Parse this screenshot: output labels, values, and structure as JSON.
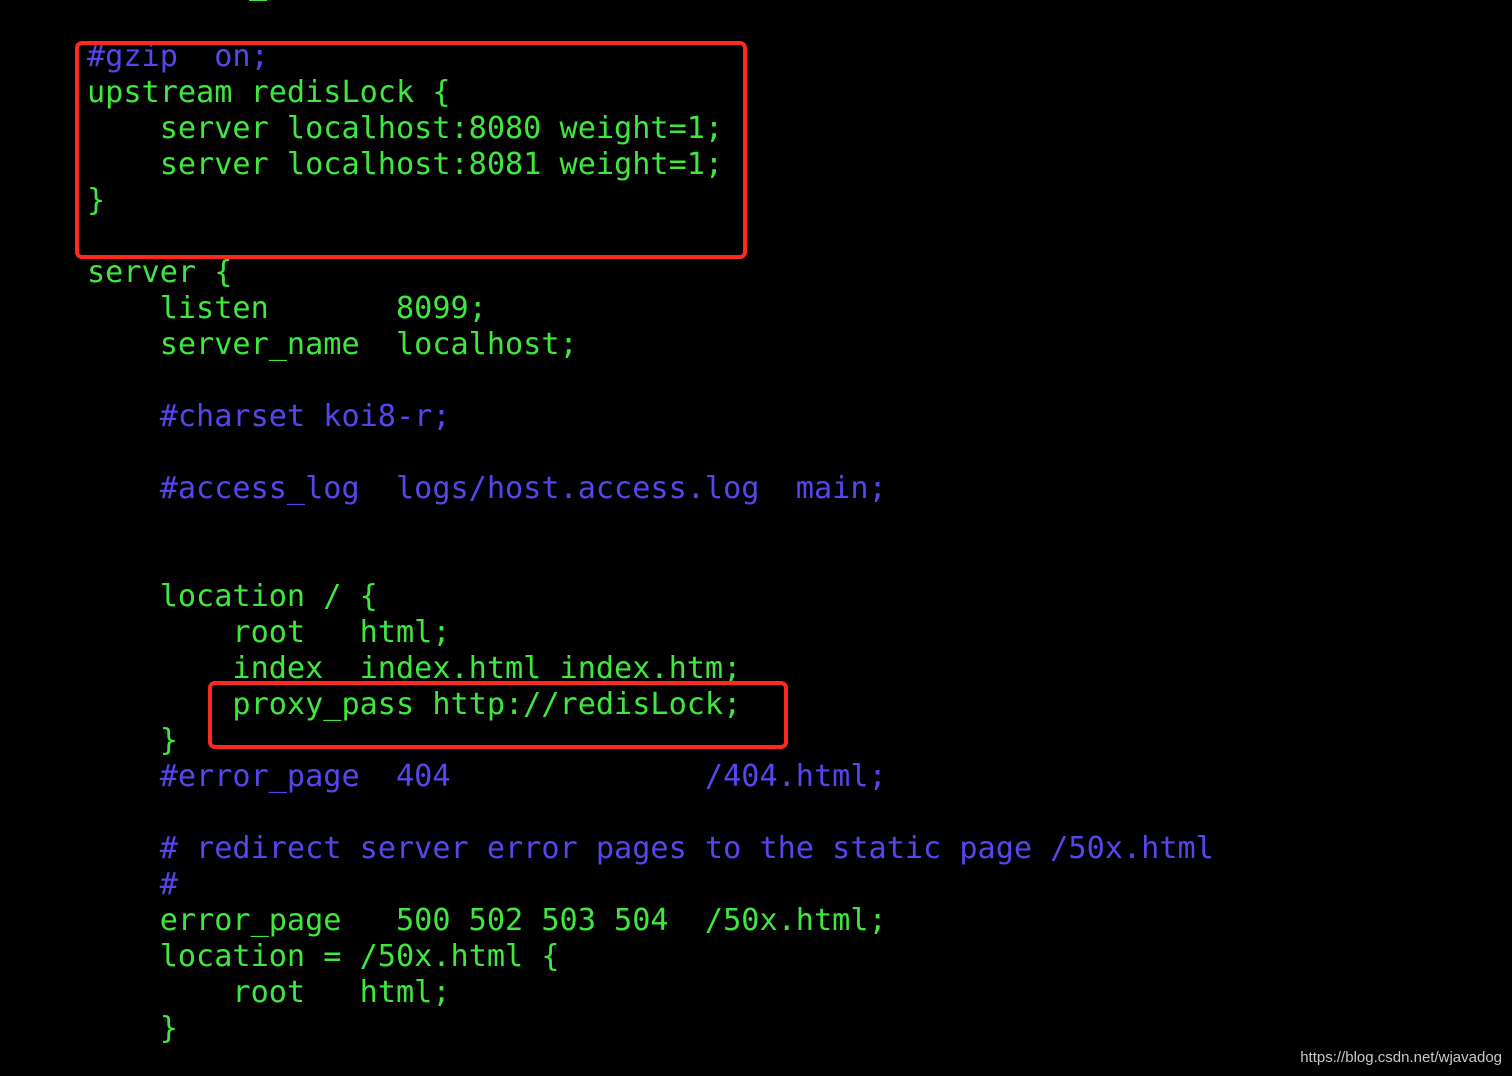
{
  "colors": {
    "code": "#3ee83e",
    "comment": "#5646ee",
    "highlight_box": "#ff2a1f",
    "background": "#000000"
  },
  "lines": [
    {
      "text": "#gzip  on;",
      "kind": "comment"
    },
    {
      "text": "upstream redisLock {",
      "kind": "code"
    },
    {
      "text": "    server localhost:8080 weight=1;",
      "kind": "code"
    },
    {
      "text": "    server localhost:8081 weight=1;",
      "kind": "code"
    },
    {
      "text": "}",
      "kind": "code"
    },
    {
      "text": "",
      "kind": "code"
    },
    {
      "text": "server {",
      "kind": "code"
    },
    {
      "text": "    listen       8099;",
      "kind": "code"
    },
    {
      "text": "    server_name  localhost;",
      "kind": "code"
    },
    {
      "text": "",
      "kind": "code"
    },
    {
      "text": "    #charset koi8-r;",
      "kind": "comment"
    },
    {
      "text": "",
      "kind": "code"
    },
    {
      "text": "    #access_log  logs/host.access.log  main;",
      "kind": "comment"
    },
    {
      "text": "",
      "kind": "code"
    },
    {
      "text": "",
      "kind": "code"
    },
    {
      "text": "    location / {",
      "kind": "code"
    },
    {
      "text": "        root   html;",
      "kind": "code"
    },
    {
      "text": "        index  index.html index.htm;",
      "kind": "code"
    },
    {
      "text": "        proxy_pass http://redisLock;",
      "kind": "code"
    },
    {
      "text": "    }",
      "kind": "code"
    },
    {
      "text": "    #error_page  404              /404.html;",
      "kind": "comment"
    },
    {
      "text": "",
      "kind": "code"
    },
    {
      "text": "    # redirect server error pages to the static page /50x.html",
      "kind": "comment"
    },
    {
      "text": "    #",
      "kind": "comment"
    },
    {
      "text": "    error_page   500 502 503 504  /50x.html;",
      "kind": "code"
    },
    {
      "text": "    location = /50x.html {",
      "kind": "code"
    },
    {
      "text": "        root   html;",
      "kind": "code"
    },
    {
      "text": "    }",
      "kind": "code"
    }
  ],
  "watermark": "https://blog.csdn.net/wjavadog"
}
